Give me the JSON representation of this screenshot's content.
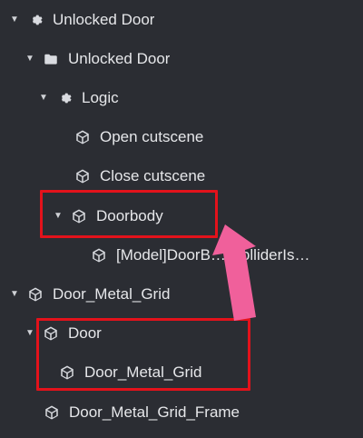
{
  "tree": {
    "items": [
      {
        "label": "Unlocked Door",
        "icon": "gear-icon",
        "expanded": true
      },
      {
        "label": "Unlocked Door",
        "icon": "folder-icon",
        "expanded": true
      },
      {
        "label": "Logic",
        "icon": "gear-icon",
        "expanded": true
      },
      {
        "label": "Open cutscene",
        "icon": "cube-icon",
        "expanded": false
      },
      {
        "label": "Close cutscene",
        "icon": "cube-icon",
        "expanded": false
      },
      {
        "label": "Doorbody",
        "icon": "cube-icon",
        "expanded": true
      },
      {
        "label": "[Model]DoorB…[ColliderIs…",
        "icon": "cube-icon",
        "expanded": false
      },
      {
        "label": "Door_Metal_Grid",
        "icon": "cube-icon",
        "expanded": true
      },
      {
        "label": "Door",
        "icon": "cube-icon",
        "expanded": true
      },
      {
        "label": "Door_Metal_Grid",
        "icon": "cube-icon",
        "expanded": false
      },
      {
        "label": "Door_Metal_Grid_Frame",
        "icon": "cube-icon",
        "expanded": false
      }
    ]
  },
  "annotations": {
    "highlight_color": "#e3121b",
    "arrow_color": "#f0609b"
  }
}
